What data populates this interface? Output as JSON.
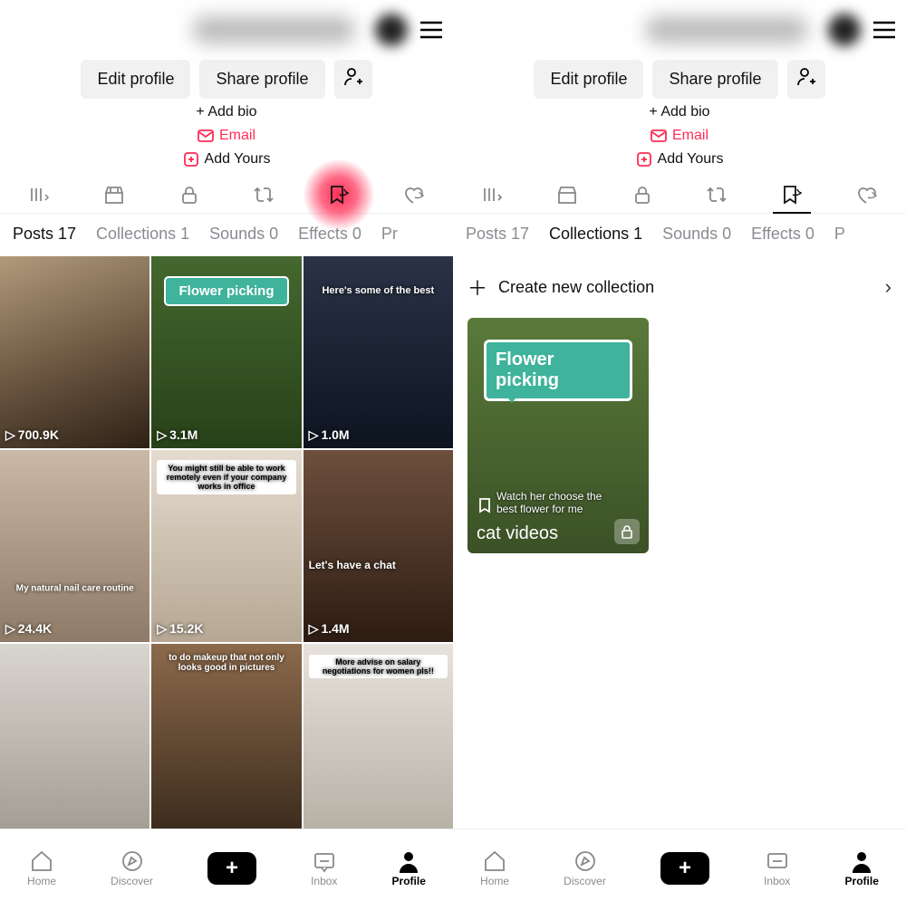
{
  "colors": {
    "accent_pink": "#fe2c55",
    "accent_cyan": "#25f4ee"
  },
  "header": {
    "edit_label": "Edit profile",
    "share_label": "Share profile",
    "add_bio": "+ Add bio",
    "email": "Email",
    "add_yours": "Add Yours"
  },
  "stripe_icons": [
    "sort-icon",
    "shop-icon",
    "lock-icon",
    "repost-icon",
    "bookmark-icon",
    "heart-hidden-icon"
  ],
  "content_tabs_left": [
    {
      "label": "Posts 17",
      "active": true
    },
    {
      "label": "Collections 1"
    },
    {
      "label": "Sounds 0"
    },
    {
      "label": "Effects 0"
    },
    {
      "label": "Pr"
    }
  ],
  "content_tabs_right": [
    {
      "label": "Posts 17"
    },
    {
      "label": "Collections 1",
      "active": true
    },
    {
      "label": "Sounds 0"
    },
    {
      "label": "Effects 0"
    },
    {
      "label": "P"
    }
  ],
  "posts": [
    {
      "views": "700.9K",
      "caption": ""
    },
    {
      "views": "3.1M",
      "caption": "Flower picking",
      "bubble": true,
      "sub": "Watch her choose the best flower for me"
    },
    {
      "views": "1.0M",
      "caption": "Here's some of the best"
    },
    {
      "views": "24.4K",
      "caption": "My natural nail care routine"
    },
    {
      "views": "15.2K",
      "caption": "You might still be able to work remotely even if your company works in office"
    },
    {
      "views": "1.4M",
      "caption": "Let's have a chat"
    },
    {
      "views": "",
      "caption": ""
    },
    {
      "views": "",
      "caption": "to do makeup that not only looks good in pictures"
    },
    {
      "views": "",
      "caption": "More advise on salary negotiations for women pls!!"
    }
  ],
  "collections": {
    "create_label": "Create new collection",
    "card_title": "Flower picking",
    "card_sub": "Watch her choose the best flower for me",
    "card_name": "cat videos"
  },
  "nav": {
    "home": "Home",
    "discover": "Discover",
    "inbox": "Inbox",
    "profile": "Profile"
  }
}
